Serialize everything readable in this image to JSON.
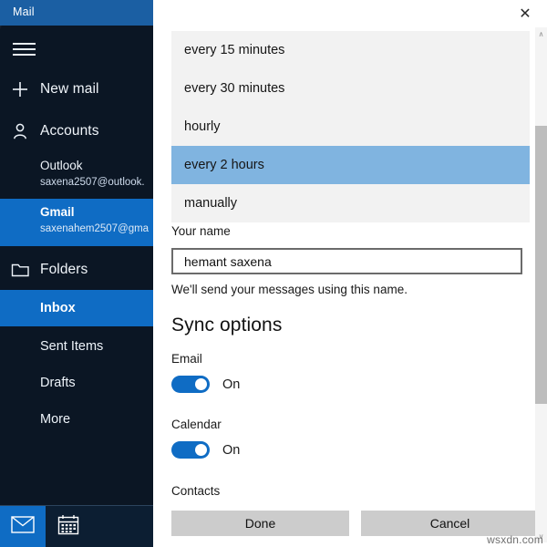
{
  "window": {
    "title": "Mail"
  },
  "sidebar": {
    "menu_icon": "hamburger-icon",
    "actions": [
      {
        "label": "New mail",
        "icon": "plus-icon"
      },
      {
        "label": "Accounts",
        "icon": "person-icon"
      }
    ],
    "accounts": [
      {
        "name": "Outlook",
        "email": "saxena2507@outlook.",
        "selected": false
      },
      {
        "name": "Gmail",
        "email": "saxenahem2507@gma",
        "selected": true
      }
    ],
    "folders_header": {
      "label": "Folders",
      "icon": "folder-icon"
    },
    "folders": [
      {
        "label": "Inbox",
        "selected": true
      },
      {
        "label": "Sent Items",
        "selected": false
      },
      {
        "label": "Drafts",
        "selected": false
      },
      {
        "label": "More",
        "selected": false
      }
    ],
    "bottom_bar": [
      {
        "icon": "mail-icon",
        "active": true
      },
      {
        "icon": "calendar-icon",
        "active": false
      }
    ]
  },
  "dialog": {
    "close_label": "✕",
    "sync_frequency": {
      "options": [
        "every 15 minutes",
        "every 30 minutes",
        "hourly",
        "every 2 hours",
        "manually"
      ],
      "selected": "every 2 hours"
    },
    "your_name": {
      "label": "Your name",
      "value": "hemant saxena",
      "placeholder": "Your name",
      "helper": "We'll send your messages using this name."
    },
    "sync_options": {
      "title": "Sync options",
      "items": [
        {
          "label": "Email",
          "state": "On",
          "on": true
        },
        {
          "label": "Calendar",
          "state": "On",
          "on": true
        },
        {
          "label": "Contacts",
          "state": "",
          "on": true
        }
      ]
    },
    "buttons": {
      "done": "Done",
      "cancel": "Cancel"
    }
  },
  "scrollbar": {
    "up_arrow": "∧",
    "down_arrow": "∨"
  },
  "watermark": "wsxdn.com",
  "colors": {
    "accent_blue": "#0f6cc4",
    "title_blue": "#1b5fa3",
    "highlight_blue": "#80b4e0",
    "dropdown_bg": "#f2f2f2",
    "button_gray": "#cccccc"
  }
}
